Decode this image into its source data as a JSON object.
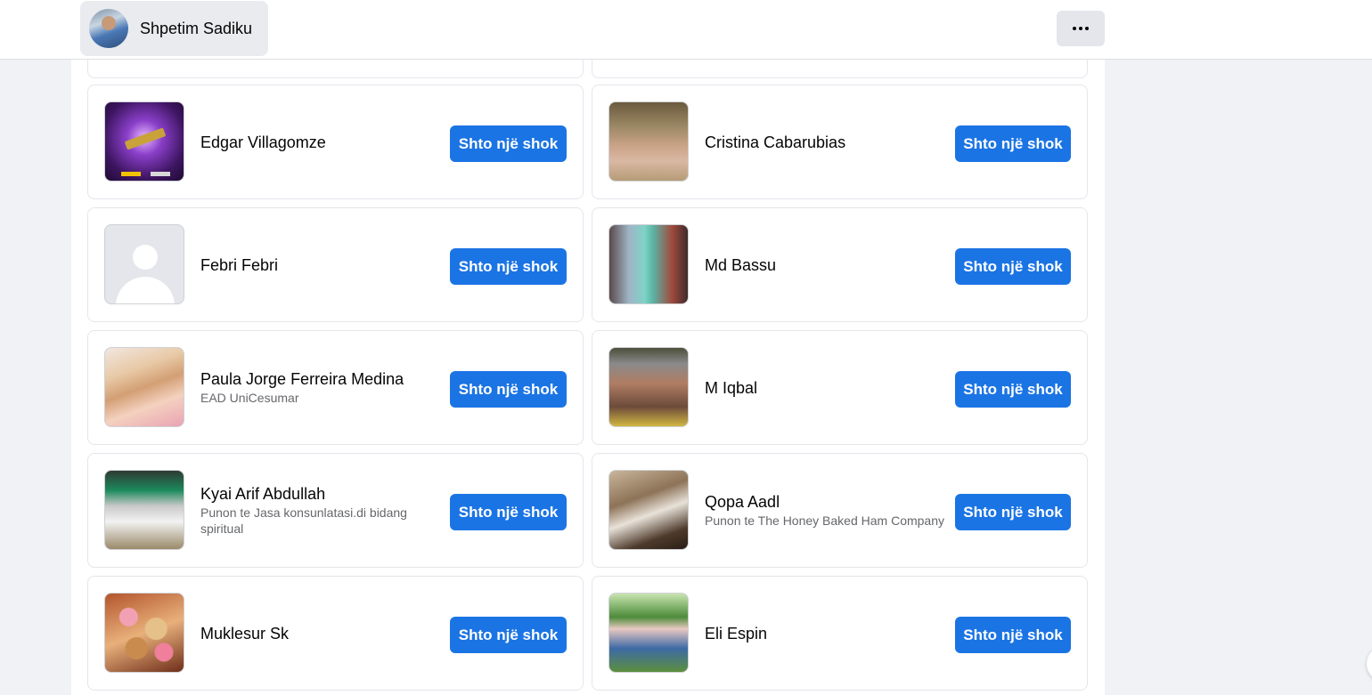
{
  "header": {
    "profile_name": "Shpetim Sadiku",
    "more_icon": "more-horizontal-icon"
  },
  "add_label": "Shto një shok",
  "people": [
    {
      "name": "Edgar Villagomze",
      "sub": "",
      "photo": "weapon-game-image"
    },
    {
      "name": "Cristina Cabarubias",
      "sub": "",
      "photo": "woman-portrait"
    },
    {
      "name": "Febri Febri",
      "sub": "",
      "photo": "default-avatar"
    },
    {
      "name": "Md Bassu",
      "sub": "",
      "photo": "man-green-outfit"
    },
    {
      "name": "Paula Jorge Ferreira Medina",
      "sub": "EAD UniCesumar",
      "photo": "woman-blonde"
    },
    {
      "name": "M Iqbal",
      "sub": "",
      "photo": "man-portrait"
    },
    {
      "name": "Kyai Arif Abdullah",
      "sub": "Punon te Jasa konsunlatasi.di bidang spiritual",
      "photo": "man-green-turban"
    },
    {
      "name": "Qopa Aadl",
      "sub": "Punon te The Honey Baked Ham Company",
      "photo": "man-reading"
    },
    {
      "name": "Muklesur Sk",
      "sub": "",
      "photo": "cookies-plate"
    },
    {
      "name": "Eli Espin",
      "sub": "",
      "photo": "woman-park"
    }
  ],
  "colors": {
    "accent": "#1b74e4",
    "background": "#f0f2f5",
    "card_border": "#e4e6eb"
  }
}
